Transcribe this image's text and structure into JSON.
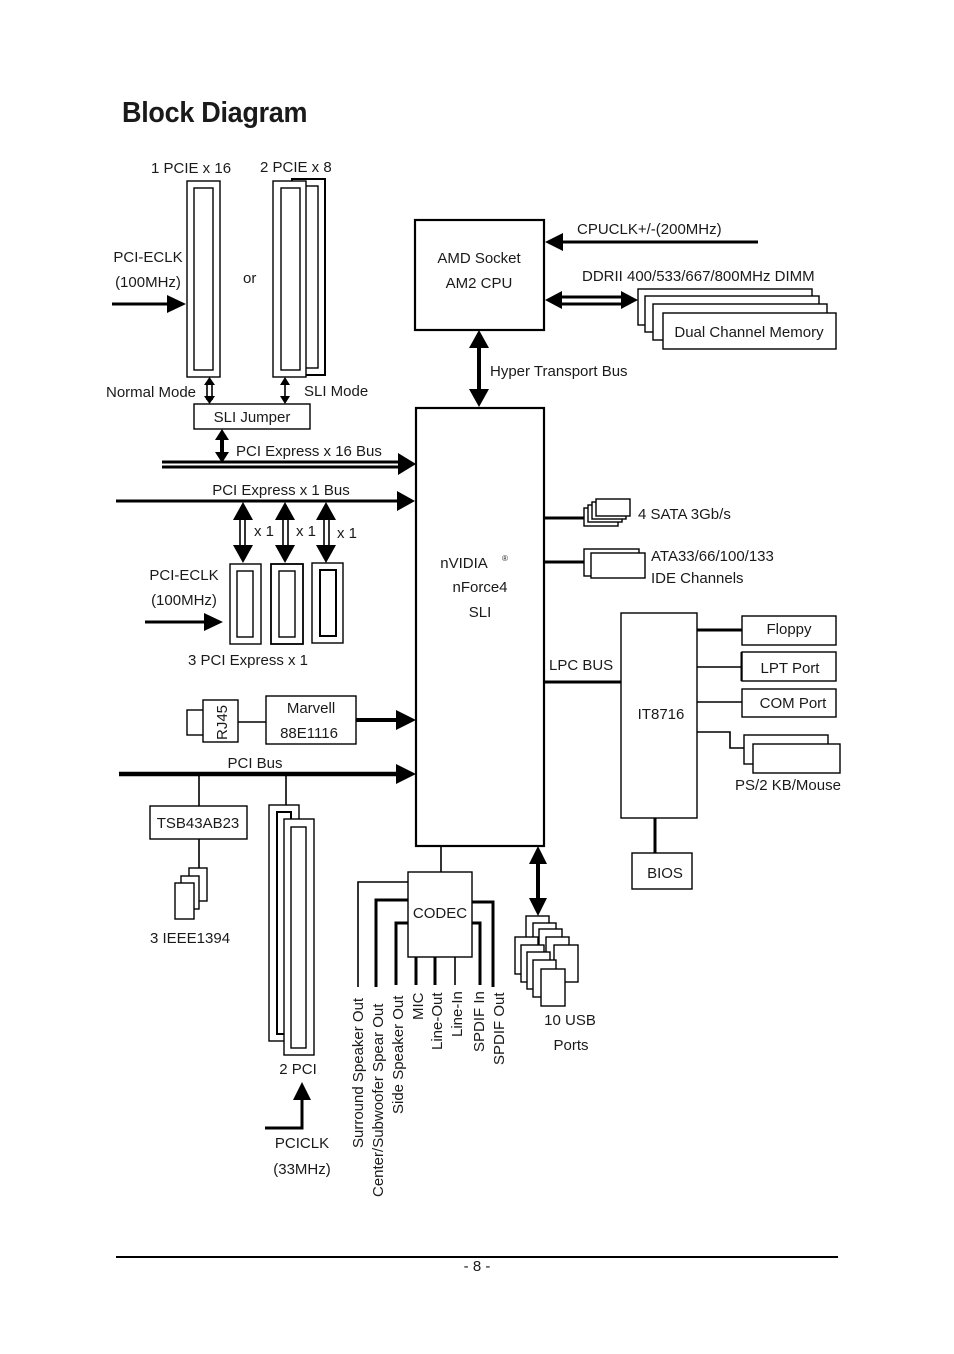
{
  "page": {
    "title": "Block Diagram",
    "page_number": "- 8 -"
  },
  "diagram": {
    "cpu": {
      "line1": "AMD Socket",
      "line2": "AM2 CPU"
    },
    "cpu_clock": "CPUCLK+/-(200MHz)",
    "memory_spec": "DDRII 400/533/667/800MHz DIMM",
    "memory": "Dual Channel Memory",
    "ht_bus": "Hyper Transport Bus",
    "chipset": {
      "line1": "nVIDIA",
      "reg": "®",
      "line2": "nForce4",
      "line3": "SLI"
    },
    "pcie16": {
      "label": "1 PCIE x 16",
      "or": "or",
      "mode": "Normal Mode"
    },
    "pcie8": {
      "label": "2 PCIE x 8",
      "mode": "SLI Mode"
    },
    "pcieclk_top": {
      "line1": "PCI-ECLK",
      "line2": "(100MHz)"
    },
    "sli_jumper": "SLI Jumper",
    "pcie16_bus": "PCI Express x 16 Bus",
    "pcie1_bus": "PCI Express x 1 Bus",
    "x1_labels": [
      "x 1",
      "x 1",
      "x 1"
    ],
    "pcieclk_mid": {
      "line1": "PCI-ECLK",
      "line2": "(100MHz)"
    },
    "pcie1_slots": "3 PCI Express x 1",
    "rj45": "RJ45",
    "lan": {
      "line1": "Marvell",
      "line2": "88E1116"
    },
    "pci_bus": "PCI Bus",
    "firewire_chip": "TSB43AB23",
    "firewire_ports": "3 IEEE1394",
    "pci_slots": "2 PCI",
    "pciclk": {
      "line1": "PCICLK",
      "line2": "(33MHz)"
    },
    "sata": "4 SATA 3Gb/s",
    "ide": {
      "line1": "ATA33/66/100/133",
      "line2": "IDE Channels"
    },
    "lpc_bus": "LPC BUS",
    "superio": "IT8716",
    "floppy": "Floppy",
    "lpt": "LPT Port",
    "com": "COM Port",
    "ps2": "PS/2 KB/Mouse",
    "bios": "BIOS",
    "codec": "CODEC",
    "audio_outputs": [
      "Surround Speaker Out",
      "Center/Subwoofer Spear Out",
      "Side Speaker Out",
      "MIC",
      "Line-Out",
      "Line-In",
      "SPDIF In",
      "SPDIF Out"
    ],
    "usb": {
      "line1": "10 USB",
      "line2": "Ports"
    }
  }
}
